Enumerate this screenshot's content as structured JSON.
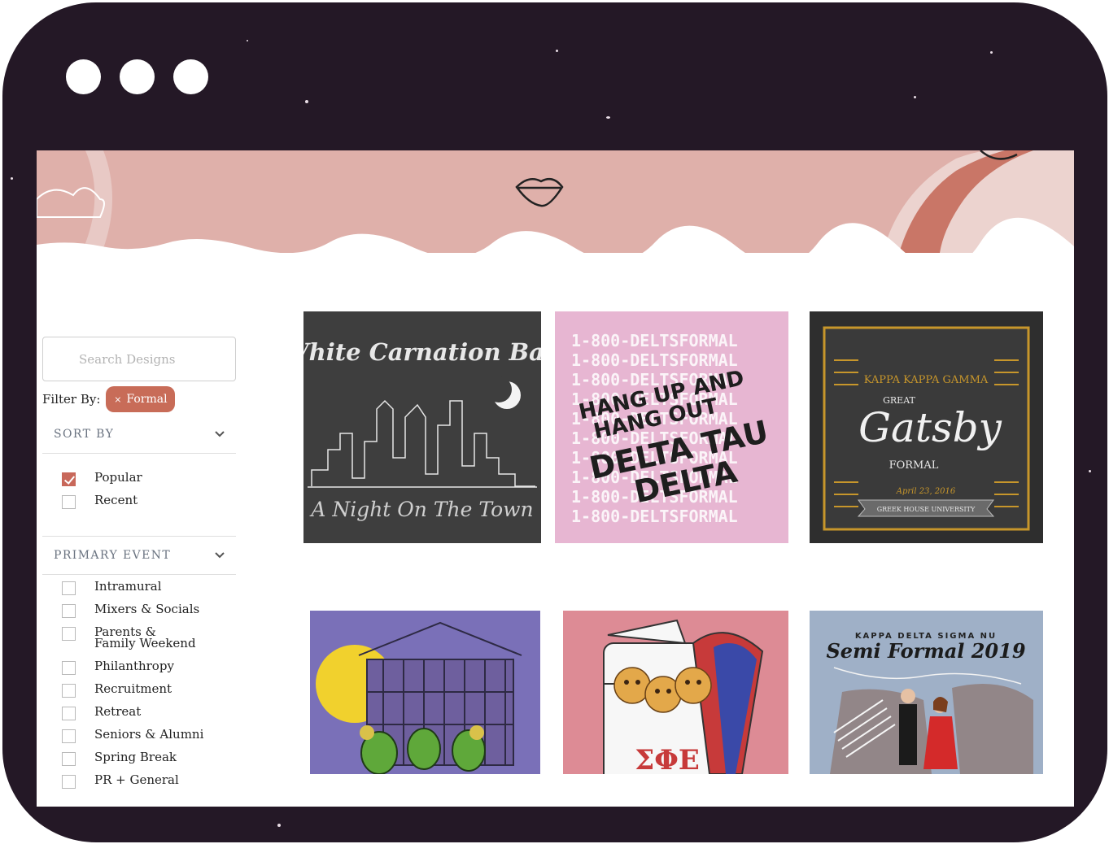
{
  "search": {
    "placeholder": "Search Designs"
  },
  "filter": {
    "label": "Filter By:",
    "chip_label": "Formal",
    "chip_remove": "×"
  },
  "sort_by": {
    "title": "SORT BY",
    "options": [
      {
        "label": "Popular",
        "checked": true
      },
      {
        "label": "Recent",
        "checked": false
      }
    ]
  },
  "primary_event": {
    "title": "PRIMARY EVENT",
    "options": [
      {
        "label": "Intramural",
        "checked": false
      },
      {
        "label": "Mixers & Socials",
        "checked": false
      },
      {
        "label": "Parents & Family Weekend",
        "checked": false
      },
      {
        "label": "Philanthropy",
        "checked": false
      },
      {
        "label": "Recruitment",
        "checked": false
      },
      {
        "label": "Retreat",
        "checked": false
      },
      {
        "label": "Seniors & Alumni",
        "checked": false
      },
      {
        "label": "Spring Break",
        "checked": false
      },
      {
        "label": "PR + General",
        "checked": false
      }
    ]
  },
  "designs": [
    {
      "title": "White Carnation Ball",
      "subtitle": "A Night On The Town",
      "bg": "#3e3e3e"
    },
    {
      "repeat": "1-800-DELTSFORMAL",
      "line1": "HANG UP AND",
      "line2": "HANG OUT",
      "line3": "DELTA TAU",
      "line4": "DELTA",
      "bg": "#e7b6d2"
    },
    {
      "org": "KAPPA KAPPA GAMMA",
      "pre": "GREAT",
      "title": "Gatsby",
      "post": "FORMAL",
      "date": "April 23, 2016",
      "ribbon": "GREEK HOUSE UNIVERSITY",
      "bg": "#2e2e2e"
    },
    {
      "bg": "#7a70b8"
    },
    {
      "letters": "ΣΦΕ",
      "bg": "#dd8b95"
    },
    {
      "org": "KAPPA DELTA SIGMA NU",
      "title": "Semi Formal 2019",
      "bg": "#9fb0c7"
    }
  ],
  "colors": {
    "frame": "#241826",
    "banner": "#dfb0aa",
    "accent": "#c86c58"
  }
}
